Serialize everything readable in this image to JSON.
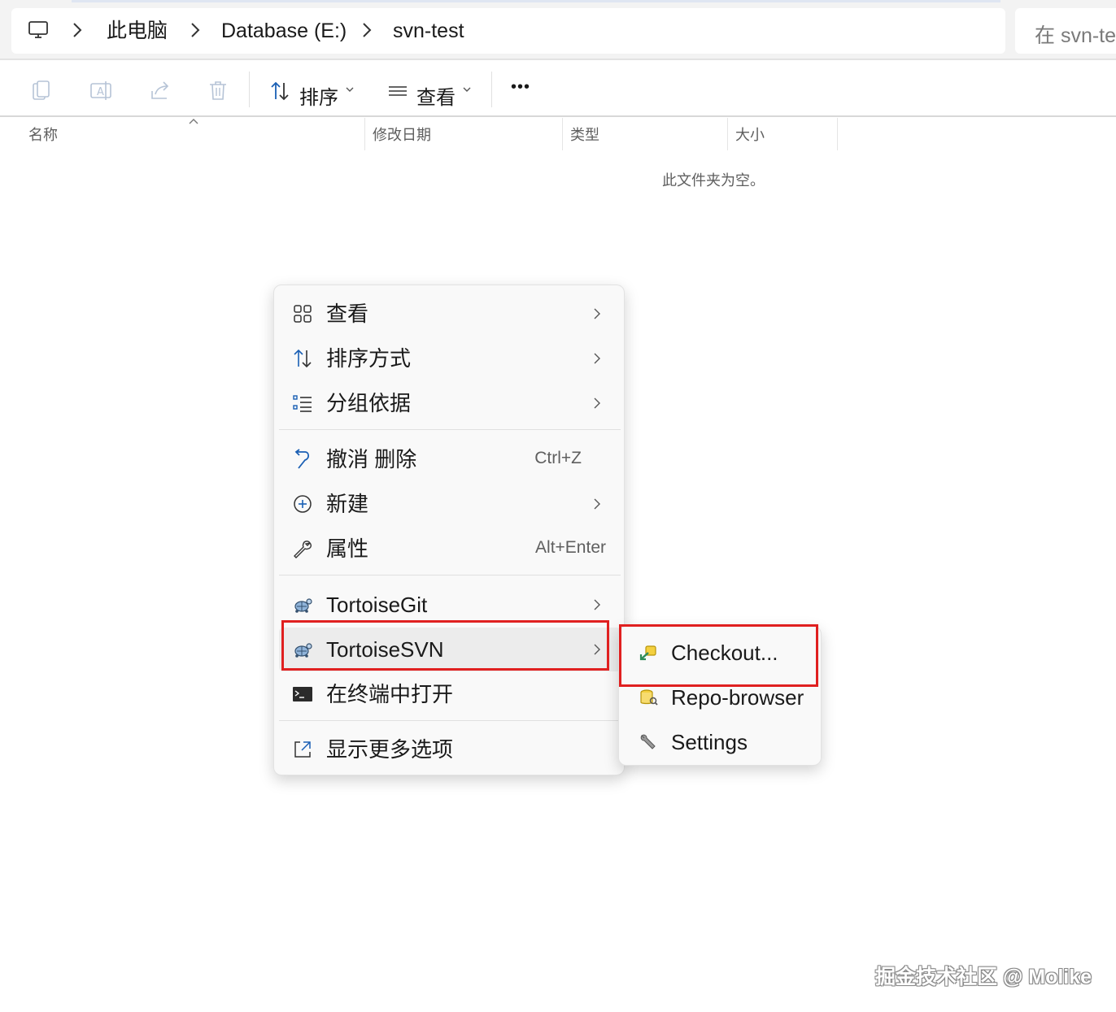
{
  "address_bar": {
    "breadcrumbs": [
      "此电脑",
      "Database (E:)",
      "svn-test"
    ],
    "search_placeholder": "在 svn-te",
    "icon": "this-pc-icon"
  },
  "toolbar": {
    "sort_label": "排序",
    "view_label": "查看",
    "more_label": "•••",
    "icons": [
      "copy-icon",
      "rename-icon",
      "share-icon",
      "delete-icon",
      "sort-icon",
      "view-icon",
      "more-icon"
    ]
  },
  "columns": [
    "名称",
    "修改日期",
    "类型",
    "大小"
  ],
  "empty_message": "此文件夹为空。",
  "context_menu": {
    "items": [
      {
        "label": "查看",
        "icon": "grid-view-icon",
        "shortcut": "",
        "submenu": true
      },
      {
        "label": "排序方式",
        "icon": "sort-icon",
        "shortcut": "",
        "submenu": true
      },
      {
        "label": "分组依据",
        "icon": "group-list-icon",
        "shortcut": "",
        "submenu": true
      },
      {
        "label": "撤消 删除",
        "icon": "undo-icon",
        "shortcut": "Ctrl+Z",
        "submenu": false
      },
      {
        "label": "新建",
        "icon": "new-plus-icon",
        "shortcut": "",
        "submenu": true
      },
      {
        "label": "属性",
        "icon": "wrench-icon",
        "shortcut": "Alt+Enter",
        "submenu": false
      },
      {
        "label": "TortoiseGit",
        "icon": "tortoise-icon",
        "shortcut": "",
        "submenu": true
      },
      {
        "label": "TortoiseSVN",
        "icon": "tortoise-icon",
        "shortcut": "",
        "submenu": true
      },
      {
        "label": "在终端中打开",
        "icon": "terminal-icon",
        "shortcut": "",
        "submenu": false
      },
      {
        "label": "显示更多选项",
        "icon": "more-options-icon",
        "shortcut": "",
        "submenu": false
      }
    ]
  },
  "submenu": {
    "items": [
      {
        "label": "Checkout...",
        "icon": "checkout-icon"
      },
      {
        "label": "Repo-browser",
        "icon": "repo-browser-icon"
      },
      {
        "label": "Settings",
        "icon": "settings-wrench-icon"
      }
    ]
  },
  "highlight_color": "#e02020",
  "watermark": "掘金技术社区 @ Molike"
}
